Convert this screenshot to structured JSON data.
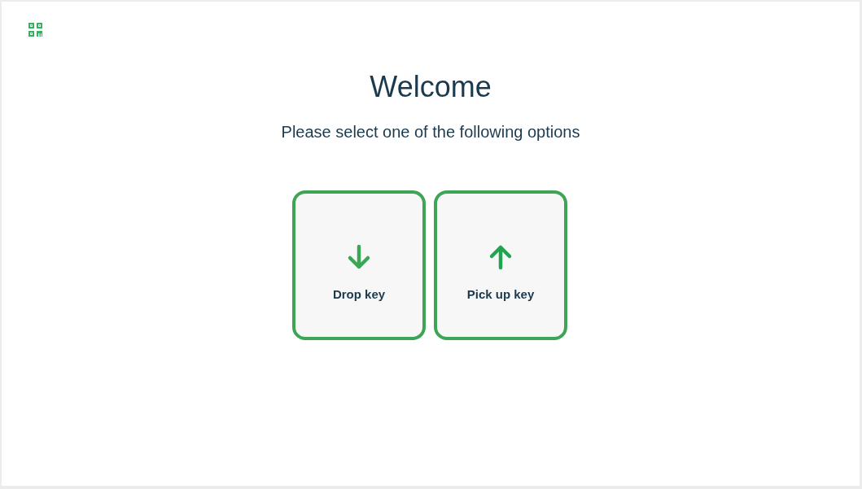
{
  "title": "Welcome",
  "subtitle": "Please select one of the following options",
  "options": [
    {
      "kind": "drop",
      "label": "Drop key"
    },
    {
      "kind": "pickup",
      "label": "Pick up key"
    }
  ]
}
